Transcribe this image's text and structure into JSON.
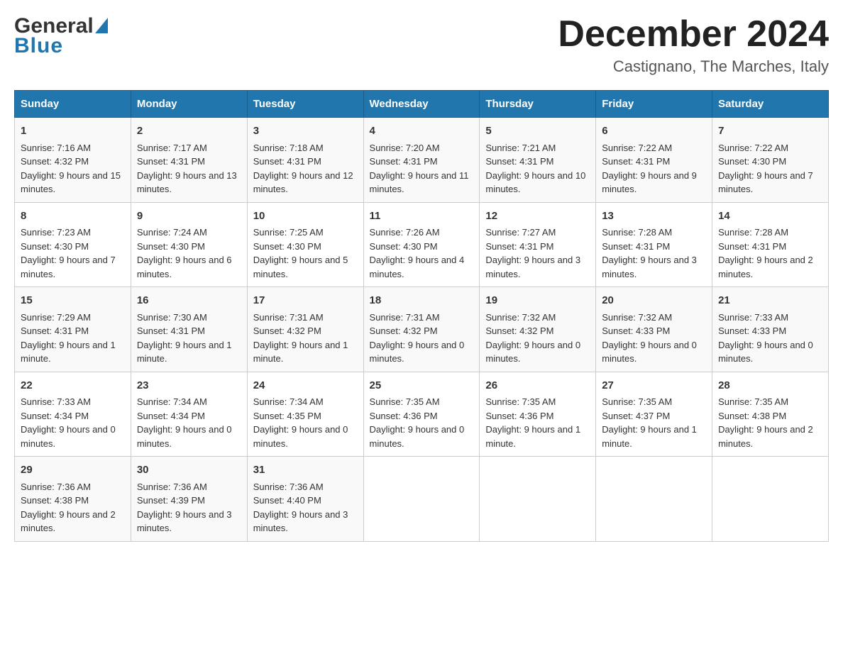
{
  "header": {
    "logo_general": "General",
    "logo_blue": "Blue",
    "main_title": "December 2024",
    "subtitle": "Castignano, The Marches, Italy"
  },
  "columns": [
    "Sunday",
    "Monday",
    "Tuesday",
    "Wednesday",
    "Thursday",
    "Friday",
    "Saturday"
  ],
  "weeks": [
    [
      {
        "day": "1",
        "sunrise": "7:16 AM",
        "sunset": "4:32 PM",
        "daylight": "9 hours and 15 minutes."
      },
      {
        "day": "2",
        "sunrise": "7:17 AM",
        "sunset": "4:31 PM",
        "daylight": "9 hours and 13 minutes."
      },
      {
        "day": "3",
        "sunrise": "7:18 AM",
        "sunset": "4:31 PM",
        "daylight": "9 hours and 12 minutes."
      },
      {
        "day": "4",
        "sunrise": "7:20 AM",
        "sunset": "4:31 PM",
        "daylight": "9 hours and 11 minutes."
      },
      {
        "day": "5",
        "sunrise": "7:21 AM",
        "sunset": "4:31 PM",
        "daylight": "9 hours and 10 minutes."
      },
      {
        "day": "6",
        "sunrise": "7:22 AM",
        "sunset": "4:31 PM",
        "daylight": "9 hours and 9 minutes."
      },
      {
        "day": "7",
        "sunrise": "7:22 AM",
        "sunset": "4:30 PM",
        "daylight": "9 hours and 7 minutes."
      }
    ],
    [
      {
        "day": "8",
        "sunrise": "7:23 AM",
        "sunset": "4:30 PM",
        "daylight": "9 hours and 7 minutes."
      },
      {
        "day": "9",
        "sunrise": "7:24 AM",
        "sunset": "4:30 PM",
        "daylight": "9 hours and 6 minutes."
      },
      {
        "day": "10",
        "sunrise": "7:25 AM",
        "sunset": "4:30 PM",
        "daylight": "9 hours and 5 minutes."
      },
      {
        "day": "11",
        "sunrise": "7:26 AM",
        "sunset": "4:30 PM",
        "daylight": "9 hours and 4 minutes."
      },
      {
        "day": "12",
        "sunrise": "7:27 AM",
        "sunset": "4:31 PM",
        "daylight": "9 hours and 3 minutes."
      },
      {
        "day": "13",
        "sunrise": "7:28 AM",
        "sunset": "4:31 PM",
        "daylight": "9 hours and 3 minutes."
      },
      {
        "day": "14",
        "sunrise": "7:28 AM",
        "sunset": "4:31 PM",
        "daylight": "9 hours and 2 minutes."
      }
    ],
    [
      {
        "day": "15",
        "sunrise": "7:29 AM",
        "sunset": "4:31 PM",
        "daylight": "9 hours and 1 minute."
      },
      {
        "day": "16",
        "sunrise": "7:30 AM",
        "sunset": "4:31 PM",
        "daylight": "9 hours and 1 minute."
      },
      {
        "day": "17",
        "sunrise": "7:31 AM",
        "sunset": "4:32 PM",
        "daylight": "9 hours and 1 minute."
      },
      {
        "day": "18",
        "sunrise": "7:31 AM",
        "sunset": "4:32 PM",
        "daylight": "9 hours and 0 minutes."
      },
      {
        "day": "19",
        "sunrise": "7:32 AM",
        "sunset": "4:32 PM",
        "daylight": "9 hours and 0 minutes."
      },
      {
        "day": "20",
        "sunrise": "7:32 AM",
        "sunset": "4:33 PM",
        "daylight": "9 hours and 0 minutes."
      },
      {
        "day": "21",
        "sunrise": "7:33 AM",
        "sunset": "4:33 PM",
        "daylight": "9 hours and 0 minutes."
      }
    ],
    [
      {
        "day": "22",
        "sunrise": "7:33 AM",
        "sunset": "4:34 PM",
        "daylight": "9 hours and 0 minutes."
      },
      {
        "day": "23",
        "sunrise": "7:34 AM",
        "sunset": "4:34 PM",
        "daylight": "9 hours and 0 minutes."
      },
      {
        "day": "24",
        "sunrise": "7:34 AM",
        "sunset": "4:35 PM",
        "daylight": "9 hours and 0 minutes."
      },
      {
        "day": "25",
        "sunrise": "7:35 AM",
        "sunset": "4:36 PM",
        "daylight": "9 hours and 0 minutes."
      },
      {
        "day": "26",
        "sunrise": "7:35 AM",
        "sunset": "4:36 PM",
        "daylight": "9 hours and 1 minute."
      },
      {
        "day": "27",
        "sunrise": "7:35 AM",
        "sunset": "4:37 PM",
        "daylight": "9 hours and 1 minute."
      },
      {
        "day": "28",
        "sunrise": "7:35 AM",
        "sunset": "4:38 PM",
        "daylight": "9 hours and 2 minutes."
      }
    ],
    [
      {
        "day": "29",
        "sunrise": "7:36 AM",
        "sunset": "4:38 PM",
        "daylight": "9 hours and 2 minutes."
      },
      {
        "day": "30",
        "sunrise": "7:36 AM",
        "sunset": "4:39 PM",
        "daylight": "9 hours and 3 minutes."
      },
      {
        "day": "31",
        "sunrise": "7:36 AM",
        "sunset": "4:40 PM",
        "daylight": "9 hours and 3 minutes."
      },
      null,
      null,
      null,
      null
    ]
  ],
  "labels": {
    "sunrise_prefix": "Sunrise: ",
    "sunset_prefix": "Sunset: ",
    "daylight_prefix": "Daylight: "
  }
}
